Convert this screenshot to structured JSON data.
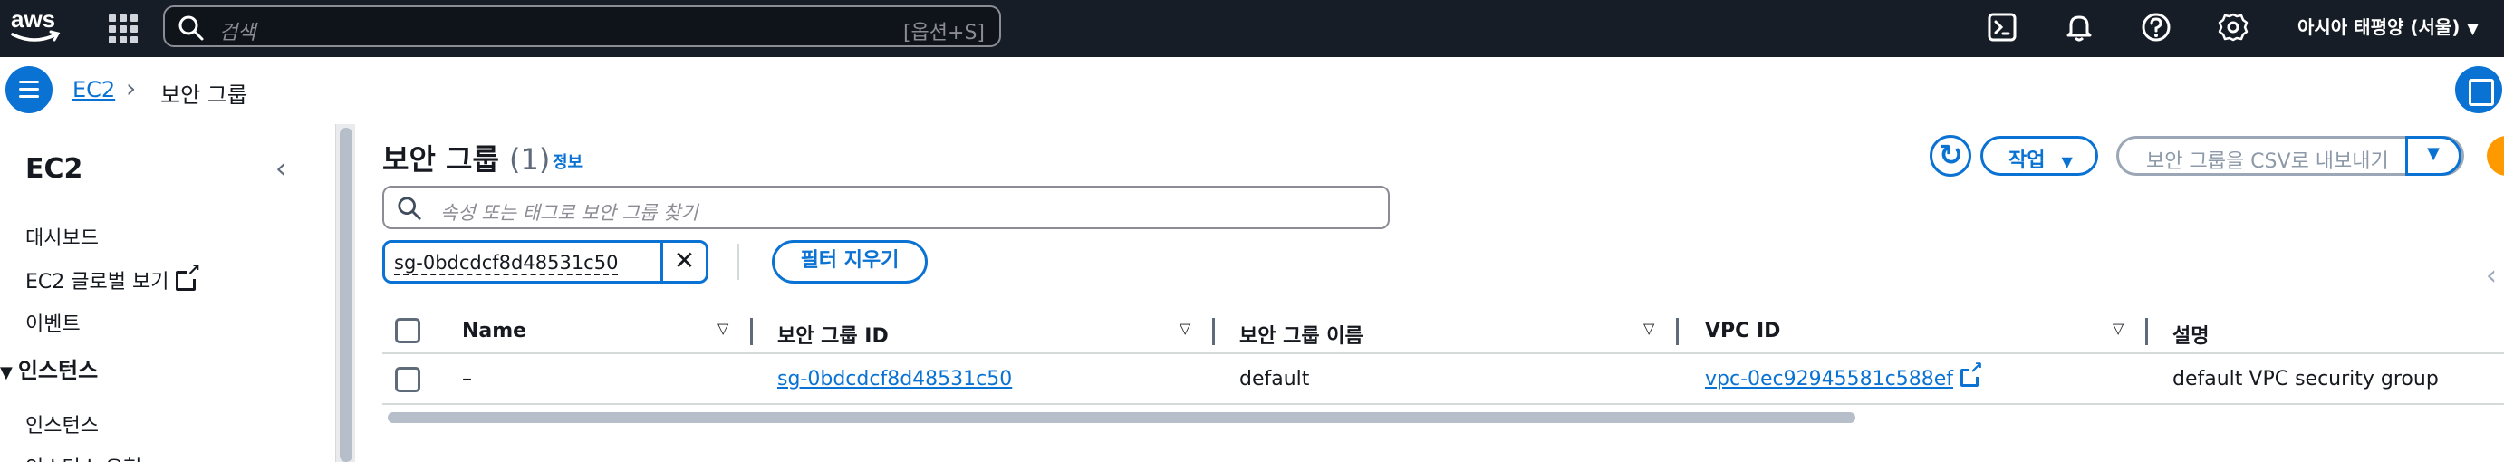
{
  "topnav": {
    "search_placeholder": "검색",
    "search_shortcut": "[옵션+S]",
    "region": "아시아 태평양 (서울)"
  },
  "breadcrumb": {
    "root": "EC2",
    "current": "보안 그룹"
  },
  "sidebar": {
    "title": "EC2",
    "items": [
      "대시보드",
      "EC2 글로벌 보기",
      "이벤트"
    ],
    "section": "인스턴스",
    "section_items": [
      "인스턴스",
      "인스턴스 유형"
    ]
  },
  "main": {
    "title": "보안 그룹",
    "count": "(1)",
    "info": "정보",
    "actions_label": "작업",
    "export_label": "보안 그룹을 CSV로 내보내기",
    "search_placeholder": "속성 또는 태그로 보안 그룹 찾기",
    "filter_token": "sg-0bdcdcf8d48531c50",
    "clear_filters": "필터 지우기"
  },
  "table": {
    "columns": [
      "Name",
      "보안 그룹 ID",
      "보안 그룹 이름",
      "VPC ID",
      "설명"
    ],
    "rows": [
      {
        "name": "–",
        "sg_id": "sg-0bdcdcf8d48531c50",
        "sg_name": "default",
        "vpc_id": "vpc-0ec92945581c588ef",
        "description": "default VPC security group"
      }
    ]
  },
  "colors": {
    "nav_bg": "#161d26",
    "accent": "#0972d3",
    "orange": "#ff9900"
  }
}
